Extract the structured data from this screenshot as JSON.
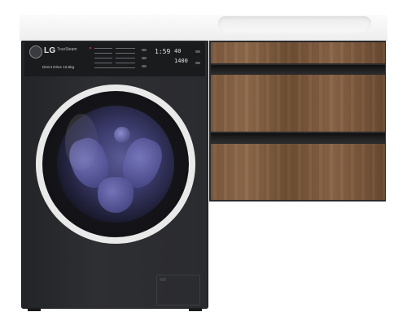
{
  "washer": {
    "brand": "LG",
    "sub_brand": "TrueSteam",
    "capacity_label": "Direct Drive 10.5kg",
    "display": {
      "time": "1:59",
      "temp": "40",
      "spin": "1400"
    }
  },
  "colors": {
    "washer_body": "#2a2b2e",
    "countertop": "#f4f4f4",
    "wood": "#7d5a3e",
    "door_trim": "#e9e9e9",
    "drum_glow": "#5a5a96"
  }
}
